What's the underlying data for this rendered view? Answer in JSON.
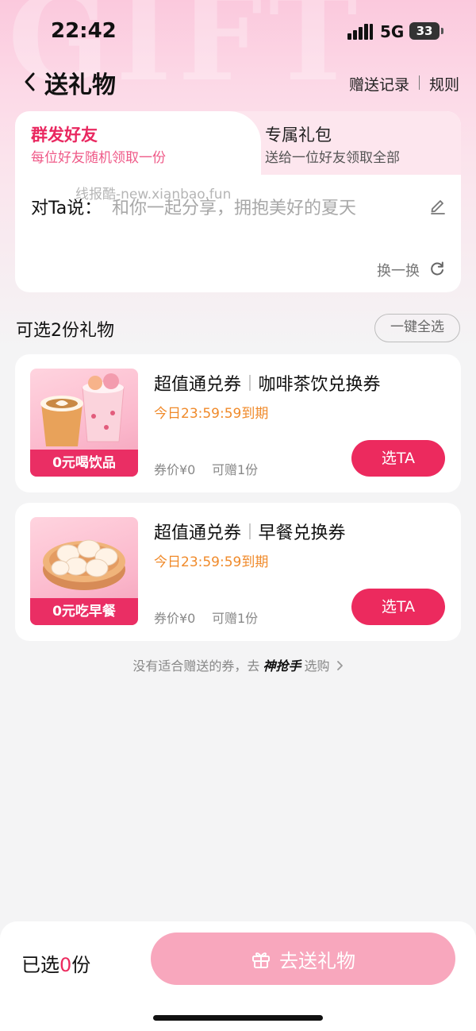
{
  "status_bar": {
    "time": "22:42",
    "network": "5G",
    "battery": "33"
  },
  "background_watermark": "GIFT",
  "nav": {
    "title": "送礼物",
    "record_link": "赠送记录",
    "rules_link": "规则"
  },
  "send_card": {
    "tab_group": {
      "title": "群发好友",
      "subtitle": "每位好友随机领取一份"
    },
    "tab_exclusive": {
      "title": "专属礼包",
      "subtitle": "送给一位好友领取全部"
    },
    "watermark": "线报酷-new.xianbao.fun",
    "message_label": "对Ta说：",
    "message_text": "和你一起分享，拥抱美好的夏天",
    "refresh_label": "换一换"
  },
  "section": {
    "title": "可选2份礼物",
    "select_all": "一键全选"
  },
  "gifts": [
    {
      "type": "超值通兑券",
      "name": "咖啡茶饮兑换券",
      "expiry": "今日23:59:59到期",
      "price": "券价¥0",
      "qty": "可赠1份",
      "banner": "0元喝饮品",
      "button": "选TA"
    },
    {
      "type": "超值通兑券",
      "name": "早餐兑换券",
      "expiry": "今日23:59:59到期",
      "price": "券价¥0",
      "qty": "可赠1份",
      "banner": "0元吃早餐",
      "button": "选TA"
    }
  ],
  "hint": {
    "prefix": "没有适合赠送的券，去",
    "brand": "神抢手",
    "suffix": "选购"
  },
  "bottom": {
    "selected_prefix": "已选",
    "selected_count": "0",
    "selected_suffix": "份",
    "send_button": "去送礼物"
  },
  "colors": {
    "accent": "#ec2a5e",
    "expiry": "#f08a2a",
    "send_disabled": "#f8a7bd"
  }
}
